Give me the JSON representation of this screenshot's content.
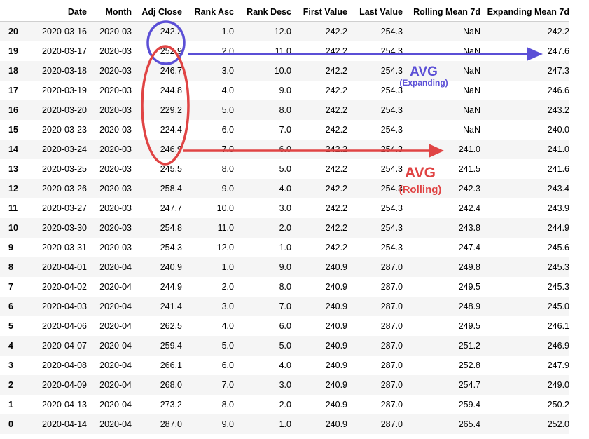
{
  "columns": [
    "",
    "Date",
    "Month",
    "Adj Close",
    "Rank Asc",
    "Rank Desc",
    "First Value",
    "Last Value",
    "Rolling Mean 7d",
    "Expanding Mean 7d"
  ],
  "rows": [
    [
      "20",
      "2020-03-16",
      "2020-03",
      "242.2",
      "1.0",
      "12.0",
      "242.2",
      "254.3",
      "NaN",
      "242.2"
    ],
    [
      "19",
      "2020-03-17",
      "2020-03",
      "252.9",
      "2.0",
      "11.0",
      "242.2",
      "254.3",
      "NaN",
      "247.6"
    ],
    [
      "18",
      "2020-03-18",
      "2020-03",
      "246.7",
      "3.0",
      "10.0",
      "242.2",
      "254.3",
      "NaN",
      "247.3"
    ],
    [
      "17",
      "2020-03-19",
      "2020-03",
      "244.8",
      "4.0",
      "9.0",
      "242.2",
      "254.3",
      "NaN",
      "246.6"
    ],
    [
      "16",
      "2020-03-20",
      "2020-03",
      "229.2",
      "5.0",
      "8.0",
      "242.2",
      "254.3",
      "NaN",
      "243.2"
    ],
    [
      "15",
      "2020-03-23",
      "2020-03",
      "224.4",
      "6.0",
      "7.0",
      "242.2",
      "254.3",
      "NaN",
      "240.0"
    ],
    [
      "14",
      "2020-03-24",
      "2020-03",
      "246.9",
      "7.0",
      "6.0",
      "242.2",
      "254.3",
      "241.0",
      "241.0"
    ],
    [
      "13",
      "2020-03-25",
      "2020-03",
      "245.5",
      "8.0",
      "5.0",
      "242.2",
      "254.3",
      "241.5",
      "241.6"
    ],
    [
      "12",
      "2020-03-26",
      "2020-03",
      "258.4",
      "9.0",
      "4.0",
      "242.2",
      "254.3",
      "242.3",
      "243.4"
    ],
    [
      "11",
      "2020-03-27",
      "2020-03",
      "247.7",
      "10.0",
      "3.0",
      "242.2",
      "254.3",
      "242.4",
      "243.9"
    ],
    [
      "10",
      "2020-03-30",
      "2020-03",
      "254.8",
      "11.0",
      "2.0",
      "242.2",
      "254.3",
      "243.8",
      "244.9"
    ],
    [
      "9",
      "2020-03-31",
      "2020-03",
      "254.3",
      "12.0",
      "1.0",
      "242.2",
      "254.3",
      "247.4",
      "245.6"
    ],
    [
      "8",
      "2020-04-01",
      "2020-04",
      "240.9",
      "1.0",
      "9.0",
      "240.9",
      "287.0",
      "249.8",
      "245.3"
    ],
    [
      "7",
      "2020-04-02",
      "2020-04",
      "244.9",
      "2.0",
      "8.0",
      "240.9",
      "287.0",
      "249.5",
      "245.3"
    ],
    [
      "6",
      "2020-04-03",
      "2020-04",
      "241.4",
      "3.0",
      "7.0",
      "240.9",
      "287.0",
      "248.9",
      "245.0"
    ],
    [
      "5",
      "2020-04-06",
      "2020-04",
      "262.5",
      "4.0",
      "6.0",
      "240.9",
      "287.0",
      "249.5",
      "246.1"
    ],
    [
      "4",
      "2020-04-07",
      "2020-04",
      "259.4",
      "5.0",
      "5.0",
      "240.9",
      "287.0",
      "251.2",
      "246.9"
    ],
    [
      "3",
      "2020-04-08",
      "2020-04",
      "266.1",
      "6.0",
      "4.0",
      "240.9",
      "287.0",
      "252.8",
      "247.9"
    ],
    [
      "2",
      "2020-04-09",
      "2020-04",
      "268.0",
      "7.0",
      "3.0",
      "240.9",
      "287.0",
      "254.7",
      "249.0"
    ],
    [
      "1",
      "2020-04-13",
      "2020-04",
      "273.2",
      "8.0",
      "2.0",
      "240.9",
      "287.0",
      "259.4",
      "250.2"
    ],
    [
      "0",
      "2020-04-14",
      "2020-04",
      "287.0",
      "9.0",
      "1.0",
      "240.9",
      "287.0",
      "265.4",
      "252.0"
    ]
  ],
  "annotations": {
    "expanding": {
      "title": "AVG",
      "subtitle": "(Expanding)",
      "color": "#5b4fd6"
    },
    "rolling": {
      "title": "AVG",
      "subtitle": "(Rolling)",
      "color": "#e04444"
    }
  }
}
